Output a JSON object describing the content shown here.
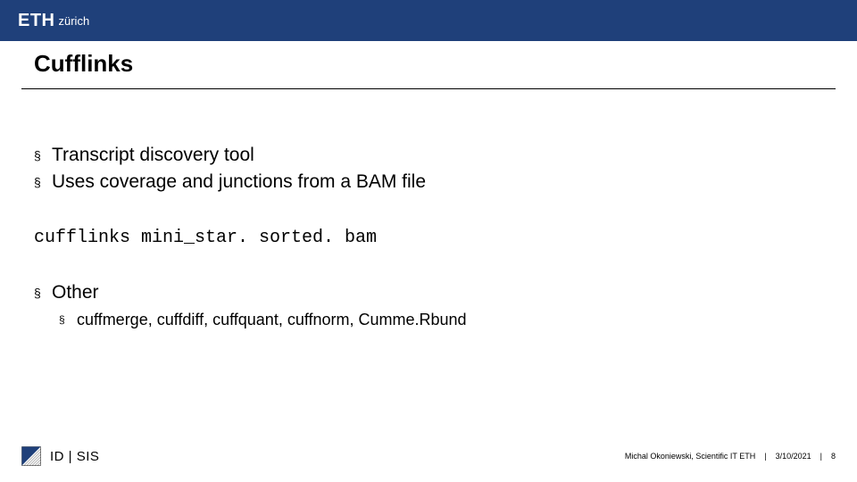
{
  "header": {
    "logo_main": "ETH",
    "logo_sub": "zürich"
  },
  "title": "Cufflinks",
  "bullets": [
    "Transcript discovery tool",
    "Uses coverage and junctions from a BAM file"
  ],
  "code_line": "cufflinks mini_star. sorted. bam",
  "other": {
    "heading": "Other",
    "sub_bullets": [
      "cuffmerge, cuffdiff, cuffquant, cuffnorm, Cumme.Rbund"
    ]
  },
  "footer": {
    "dept": "ID | SIS",
    "author": "Michal Okoniewski, Scientific IT ETH",
    "date": "3/10/2021",
    "page": "8"
  }
}
